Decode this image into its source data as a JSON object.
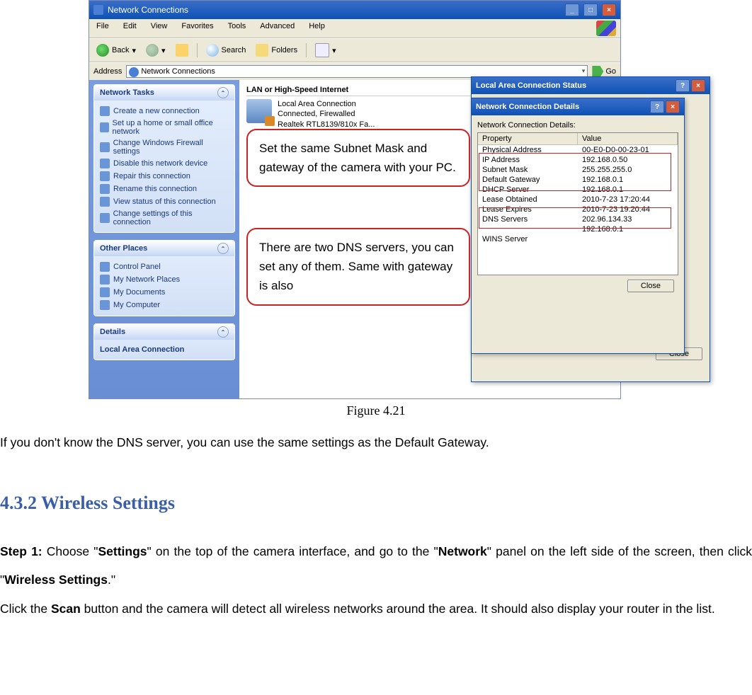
{
  "window": {
    "title": "Network Connections",
    "menu": [
      "File",
      "Edit",
      "View",
      "Favorites",
      "Tools",
      "Advanced",
      "Help"
    ],
    "toolbar": {
      "back": "Back",
      "search": "Search",
      "folders": "Folders"
    },
    "address_label": "Address",
    "address_value": "Network Connections",
    "go": "Go"
  },
  "sidebar": {
    "tasks": {
      "title": "Network Tasks",
      "items": [
        "Create a new connection",
        "Set up a home or small office network",
        "Change Windows Firewall settings",
        "Disable this network device",
        "Repair this connection",
        "Rename this connection",
        "View status of this connection",
        "Change settings of this connection"
      ]
    },
    "other": {
      "title": "Other Places",
      "items": [
        "Control Panel",
        "My Network Places",
        "My Documents",
        "My Computer"
      ]
    },
    "details": {
      "title": "Details",
      "text": "Local Area Connection"
    }
  },
  "content": {
    "section": "LAN or High-Speed Internet",
    "conn": {
      "name": "Local Area Connection",
      "status": "Connected, Firewalled",
      "device": "Realtek RTL8139/810x Fa..."
    }
  },
  "dialog_status": {
    "title": "Local Area Connection Status",
    "close": "Close"
  },
  "dialog_details": {
    "title": "Network Connection Details",
    "label": "Network Connection Details:",
    "hdr_prop": "Property",
    "hdr_val": "Value",
    "rows": [
      {
        "p": "Physical Address",
        "v": "00-E0-D0-00-23-01"
      },
      {
        "p": "IP Address",
        "v": "192.168.0.50"
      },
      {
        "p": "Subnet Mask",
        "v": "255.255.255.0"
      },
      {
        "p": "Default Gateway",
        "v": "192.168.0.1"
      },
      {
        "p": "DHCP Server",
        "v": "192.168.0.1"
      },
      {
        "p": "Lease Obtained",
        "v": "2010-7-23 17:20:44"
      },
      {
        "p": "Lease Expires",
        "v": "2010-7-23 19:20:44"
      },
      {
        "p": "DNS Servers",
        "v": "202.96.134.33"
      },
      {
        "p": "",
        "v": "192.168.0.1"
      },
      {
        "p": "WINS Server",
        "v": ""
      }
    ],
    "close": "Close"
  },
  "callouts": {
    "c1": "Set the same Subnet Mask and gateway of the camera with your PC.",
    "c2": "There are two DNS servers, you can set any of them. Same with gateway is also"
  },
  "doc": {
    "figure": "Figure 4.21",
    "p1": "If you don't know the DNS server, you can use the same settings as the Default Gateway.",
    "h": "4.3.2    Wireless Settings",
    "step1a": "Step 1:",
    "step1b": " Choose \"",
    "step1c": "Settings",
    "step1d": "\" on the top of the camera interface, and go to the \"",
    "step1e": "Network",
    "step1f": "\" panel on the left side of the screen, then click \"",
    "step1g": "Wireless Settings",
    "step1h": ".\"",
    "p2a": "Click the ",
    "p2b": "Scan",
    "p2c": " button and the camera will detect all wireless networks around the area. It should also display your router in the list."
  }
}
